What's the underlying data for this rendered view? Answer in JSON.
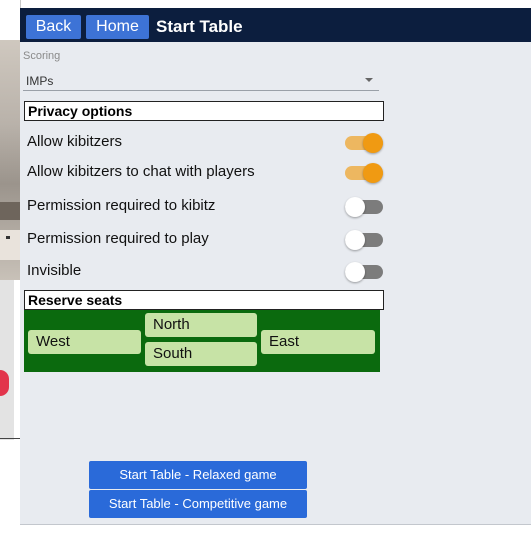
{
  "header": {
    "back_label": "Back",
    "home_label": "Home",
    "title": "Start Table"
  },
  "scoring": {
    "label": "Scoring",
    "value": "IMPs"
  },
  "privacy": {
    "heading": "Privacy options",
    "options": [
      {
        "label": "Allow kibitzers",
        "on": true
      },
      {
        "label": "Allow kibitzers to chat with players",
        "on": true
      },
      {
        "label": "Permission required to kibitz",
        "on": false
      },
      {
        "label": "Permission required to play",
        "on": false
      },
      {
        "label": "Invisible",
        "on": false
      }
    ]
  },
  "reserve": {
    "heading": "Reserve seats",
    "seats": {
      "west": "West",
      "north": "North",
      "south": "South",
      "east": "East"
    }
  },
  "actions": {
    "relaxed_label": "Start Table - Relaxed game",
    "competitive_label": "Start Table - Competitive game"
  },
  "colors": {
    "titlebar": "#0c1e3e",
    "nav_button": "#3d73d6",
    "toggle_on": "#f09a12",
    "seats_background": "#0b6a0e",
    "seat": "#c7e3a6",
    "action_button": "#2a6ad9"
  }
}
